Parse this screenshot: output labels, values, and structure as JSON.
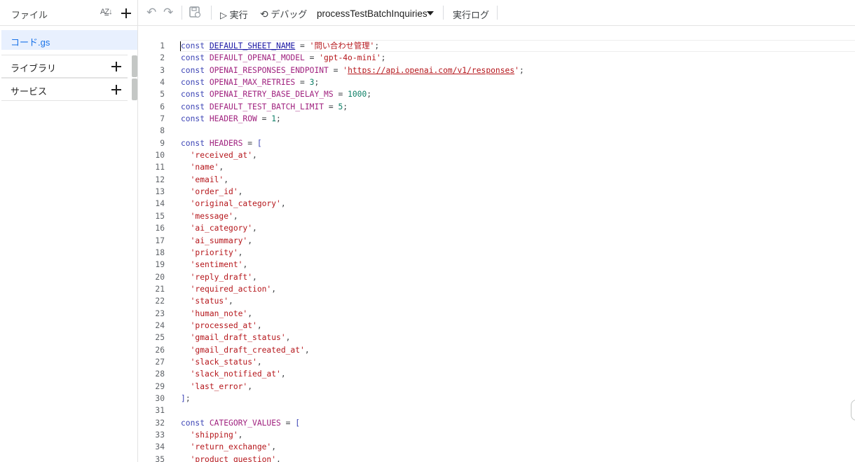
{
  "sidebar": {
    "title": "ファイル",
    "sort_icon": "sort-az-icon",
    "files": [
      {
        "name": "コード.gs",
        "active": true
      }
    ],
    "sections": [
      {
        "label": "ライブラリ"
      },
      {
        "label": "サービス"
      }
    ]
  },
  "toolbar": {
    "run_label": "▷ 実行",
    "debug_label": "デバッグ",
    "function_name": "processTestBatchInquiries",
    "log_label": "実行ログ"
  },
  "editor": {
    "lines": [
      {
        "n": "1",
        "t": [
          [
            "k",
            "const "
          ],
          [
            "hl",
            "DEFAULT_SHEET_NAME"
          ],
          [
            "op",
            " = "
          ],
          [
            "str",
            "'問い合わせ管理'"
          ],
          [
            "op",
            ";"
          ]
        ]
      },
      {
        "n": "2",
        "t": [
          [
            "k",
            "const "
          ],
          [
            "id",
            "DEFAULT_OPENAI_MODEL"
          ],
          [
            "op",
            " = "
          ],
          [
            "str",
            "'gpt-4o-mini'"
          ],
          [
            "op",
            ";"
          ]
        ]
      },
      {
        "n": "3",
        "t": [
          [
            "k",
            "const "
          ],
          [
            "id",
            "OPENAI_RESPONSES_ENDPOINT"
          ],
          [
            "op",
            " = "
          ],
          [
            "str",
            "'"
          ],
          [
            "strl",
            "https://api.openai.com/v1/responses"
          ],
          [
            "str",
            "'"
          ],
          [
            "op",
            ";"
          ]
        ]
      },
      {
        "n": "4",
        "t": [
          [
            "k",
            "const "
          ],
          [
            "id",
            "OPENAI_MAX_RETRIES"
          ],
          [
            "op",
            " = "
          ],
          [
            "num",
            "3"
          ],
          [
            "op",
            ";"
          ]
        ]
      },
      {
        "n": "5",
        "t": [
          [
            "k",
            "const "
          ],
          [
            "id",
            "OPENAI_RETRY_BASE_DELAY_MS"
          ],
          [
            "op",
            " = "
          ],
          [
            "num",
            "1000"
          ],
          [
            "op",
            ";"
          ]
        ]
      },
      {
        "n": "6",
        "t": [
          [
            "k",
            "const "
          ],
          [
            "id",
            "DEFAULT_TEST_BATCH_LIMIT"
          ],
          [
            "op",
            " = "
          ],
          [
            "num",
            "5"
          ],
          [
            "op",
            ";"
          ]
        ]
      },
      {
        "n": "7",
        "t": [
          [
            "k",
            "const "
          ],
          [
            "id",
            "HEADER_ROW"
          ],
          [
            "op",
            " = "
          ],
          [
            "num",
            "1"
          ],
          [
            "op",
            ";"
          ]
        ]
      },
      {
        "n": "8",
        "t": []
      },
      {
        "n": "9",
        "t": [
          [
            "k",
            "const "
          ],
          [
            "id",
            "HEADERS"
          ],
          [
            "op",
            " = "
          ],
          [
            "br",
            "["
          ]
        ]
      },
      {
        "n": "10",
        "t": [
          [
            "op",
            "  "
          ],
          [
            "str",
            "'received_at'"
          ],
          [
            "op",
            ","
          ]
        ]
      },
      {
        "n": "11",
        "t": [
          [
            "op",
            "  "
          ],
          [
            "str",
            "'name'"
          ],
          [
            "op",
            ","
          ]
        ]
      },
      {
        "n": "12",
        "t": [
          [
            "op",
            "  "
          ],
          [
            "str",
            "'email'"
          ],
          [
            "op",
            ","
          ]
        ]
      },
      {
        "n": "13",
        "t": [
          [
            "op",
            "  "
          ],
          [
            "str",
            "'order_id'"
          ],
          [
            "op",
            ","
          ]
        ]
      },
      {
        "n": "14",
        "t": [
          [
            "op",
            "  "
          ],
          [
            "str",
            "'original_category'"
          ],
          [
            "op",
            ","
          ]
        ]
      },
      {
        "n": "15",
        "t": [
          [
            "op",
            "  "
          ],
          [
            "str",
            "'message'"
          ],
          [
            "op",
            ","
          ]
        ]
      },
      {
        "n": "16",
        "t": [
          [
            "op",
            "  "
          ],
          [
            "str",
            "'ai_category'"
          ],
          [
            "op",
            ","
          ]
        ]
      },
      {
        "n": "17",
        "t": [
          [
            "op",
            "  "
          ],
          [
            "str",
            "'ai_summary'"
          ],
          [
            "op",
            ","
          ]
        ]
      },
      {
        "n": "18",
        "t": [
          [
            "op",
            "  "
          ],
          [
            "str",
            "'priority'"
          ],
          [
            "op",
            ","
          ]
        ]
      },
      {
        "n": "19",
        "t": [
          [
            "op",
            "  "
          ],
          [
            "str",
            "'sentiment'"
          ],
          [
            "op",
            ","
          ]
        ]
      },
      {
        "n": "20",
        "t": [
          [
            "op",
            "  "
          ],
          [
            "str",
            "'reply_draft'"
          ],
          [
            "op",
            ","
          ]
        ]
      },
      {
        "n": "21",
        "t": [
          [
            "op",
            "  "
          ],
          [
            "str",
            "'required_action'"
          ],
          [
            "op",
            ","
          ]
        ]
      },
      {
        "n": "22",
        "t": [
          [
            "op",
            "  "
          ],
          [
            "str",
            "'status'"
          ],
          [
            "op",
            ","
          ]
        ]
      },
      {
        "n": "23",
        "t": [
          [
            "op",
            "  "
          ],
          [
            "str",
            "'human_note'"
          ],
          [
            "op",
            ","
          ]
        ]
      },
      {
        "n": "24",
        "t": [
          [
            "op",
            "  "
          ],
          [
            "str",
            "'processed_at'"
          ],
          [
            "op",
            ","
          ]
        ]
      },
      {
        "n": "25",
        "t": [
          [
            "op",
            "  "
          ],
          [
            "str",
            "'gmail_draft_status'"
          ],
          [
            "op",
            ","
          ]
        ]
      },
      {
        "n": "26",
        "t": [
          [
            "op",
            "  "
          ],
          [
            "str",
            "'gmail_draft_created_at'"
          ],
          [
            "op",
            ","
          ]
        ]
      },
      {
        "n": "27",
        "t": [
          [
            "op",
            "  "
          ],
          [
            "str",
            "'slack_status'"
          ],
          [
            "op",
            ","
          ]
        ]
      },
      {
        "n": "28",
        "t": [
          [
            "op",
            "  "
          ],
          [
            "str",
            "'slack_notified_at'"
          ],
          [
            "op",
            ","
          ]
        ]
      },
      {
        "n": "29",
        "t": [
          [
            "op",
            "  "
          ],
          [
            "str",
            "'last_error'"
          ],
          [
            "op",
            ","
          ]
        ]
      },
      {
        "n": "30",
        "t": [
          [
            "br",
            "]"
          ],
          [
            "op",
            ";"
          ]
        ]
      },
      {
        "n": "31",
        "t": []
      },
      {
        "n": "32",
        "t": [
          [
            "k",
            "const "
          ],
          [
            "id",
            "CATEGORY_VALUES"
          ],
          [
            "op",
            " = "
          ],
          [
            "br",
            "["
          ]
        ]
      },
      {
        "n": "33",
        "t": [
          [
            "op",
            "  "
          ],
          [
            "str",
            "'shipping'"
          ],
          [
            "op",
            ","
          ]
        ]
      },
      {
        "n": "34",
        "t": [
          [
            "op",
            "  "
          ],
          [
            "str",
            "'return_exchange'"
          ],
          [
            "op",
            ","
          ]
        ]
      },
      {
        "n": "35",
        "t": [
          [
            "op",
            "  "
          ],
          [
            "str",
            "'product_question'"
          ],
          [
            "op",
            ","
          ]
        ]
      }
    ]
  },
  "colors": {
    "keyword": "#3b43b5",
    "identifier": "#a0227f",
    "string": "#b5161b",
    "number": "#0d7f66",
    "active_file_bg": "#e8f0fe",
    "active_file_text": "#1a73e8"
  }
}
